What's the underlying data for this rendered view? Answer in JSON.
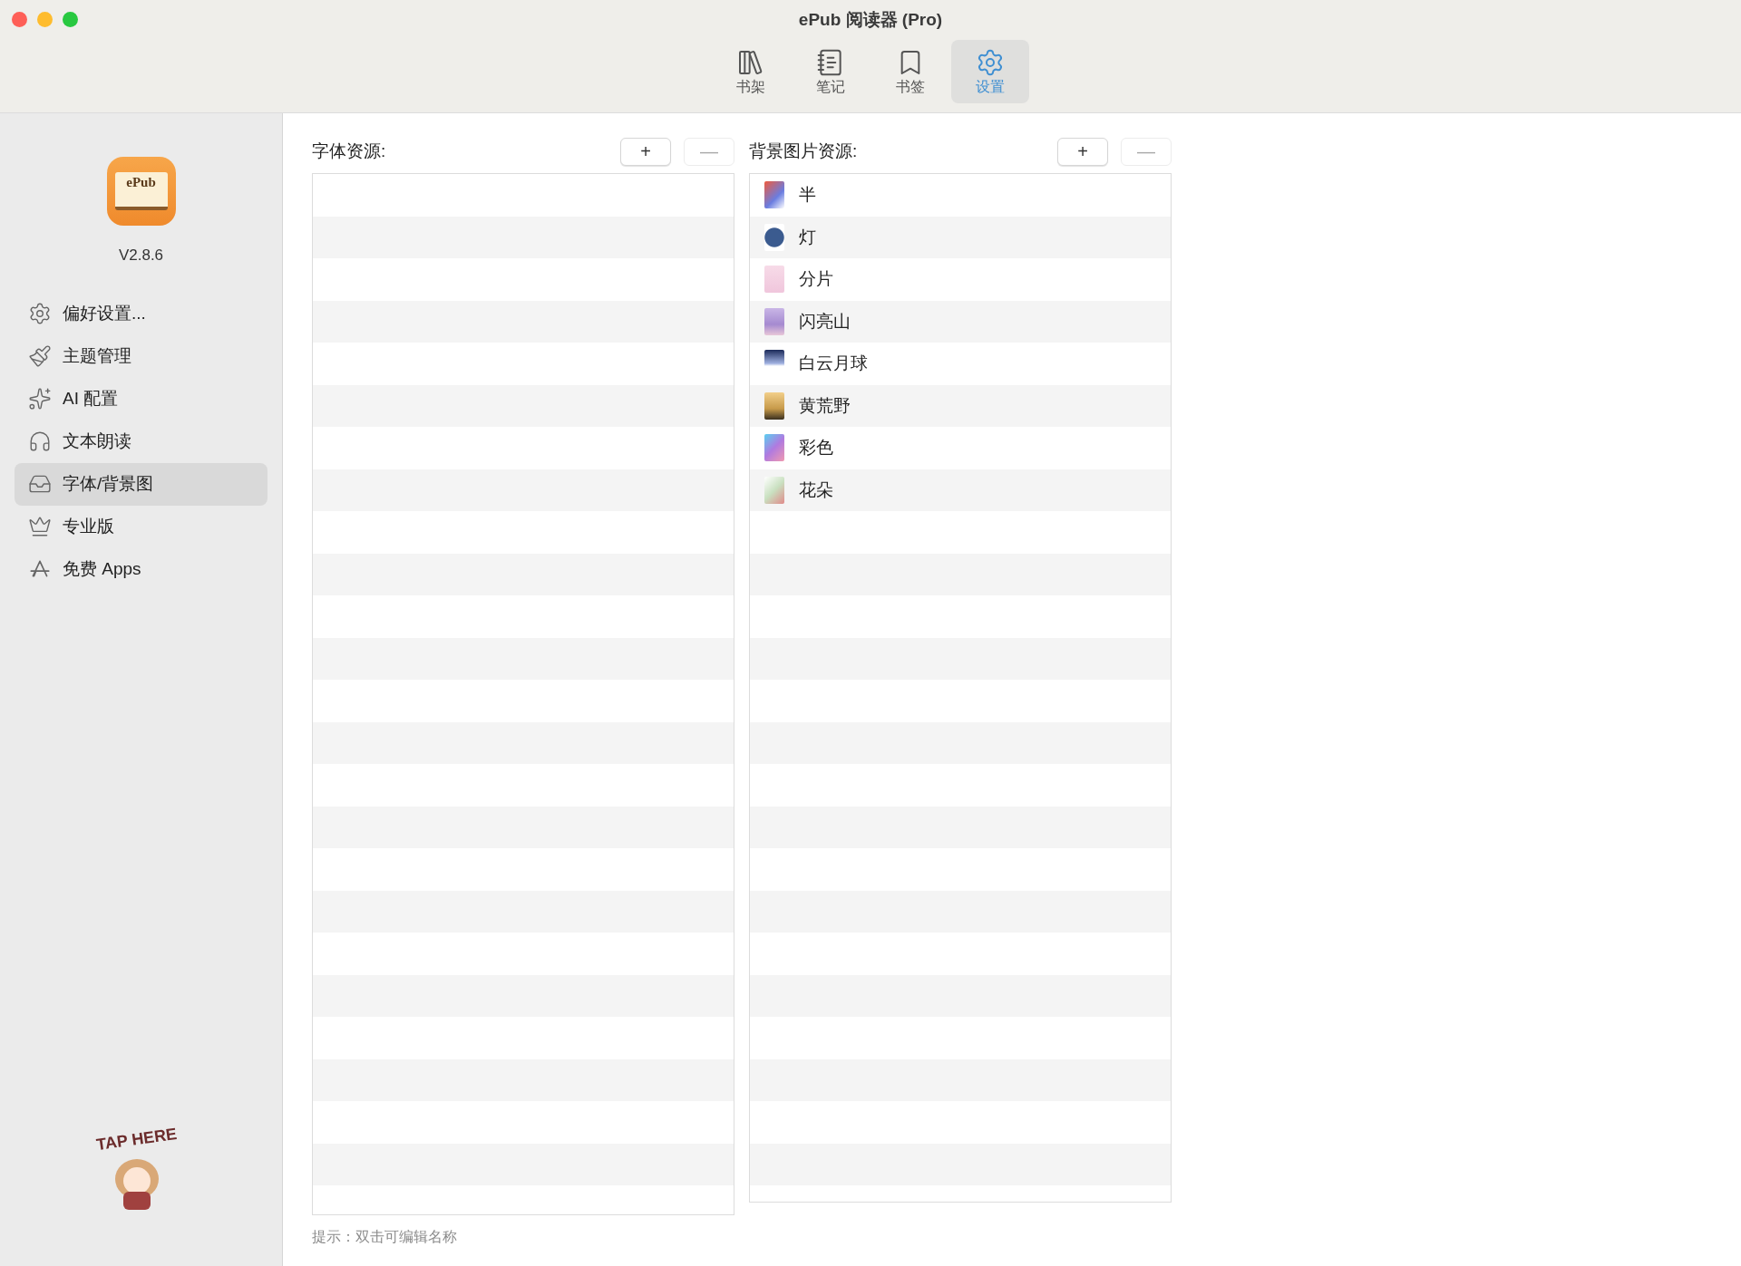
{
  "window": {
    "title": "ePub 阅读器 (Pro)"
  },
  "toolbar": [
    {
      "label": "书架",
      "kind": "bookshelf",
      "selected": false
    },
    {
      "label": "笔记",
      "kind": "notes",
      "selected": false
    },
    {
      "label": "书签",
      "kind": "bookmark",
      "selected": false
    },
    {
      "label": "设置",
      "kind": "settings",
      "selected": true
    }
  ],
  "sidebar": {
    "version": "V2.8.6",
    "logo_text": "ePub",
    "items": [
      {
        "label": "偏好设置...",
        "kind": "gear",
        "selected": false
      },
      {
        "label": "主题管理",
        "kind": "brush",
        "selected": false
      },
      {
        "label": "AI 配置",
        "kind": "sparkles",
        "selected": false
      },
      {
        "label": "文本朗读",
        "kind": "headphones",
        "selected": false
      },
      {
        "label": "字体/背景图",
        "kind": "tray",
        "selected": true
      },
      {
        "label": "专业版",
        "kind": "crown",
        "selected": false
      },
      {
        "label": "免费 Apps",
        "kind": "appstore",
        "selected": false
      }
    ],
    "sticker": "TAP HERE"
  },
  "fonts": {
    "title": "字体资源:",
    "buttons": [
      {
        "label": "+",
        "disabled": false
      },
      {
        "label": "—",
        "disabled": true
      }
    ]
  },
  "backgrounds": {
    "title": "背景图片资源:",
    "buttons": [
      {
        "label": "+",
        "disabled": false
      },
      {
        "label": "—",
        "disabled": true
      }
    ],
    "items": [
      {
        "name": "半"
      },
      {
        "name": "灯"
      },
      {
        "name": "分片"
      },
      {
        "name": "闪亮山"
      },
      {
        "name": "白云月球"
      },
      {
        "name": "黄荒野"
      },
      {
        "name": "彩色"
      },
      {
        "name": "花朵"
      }
    ]
  },
  "hint": "提示：双击可编辑名称"
}
